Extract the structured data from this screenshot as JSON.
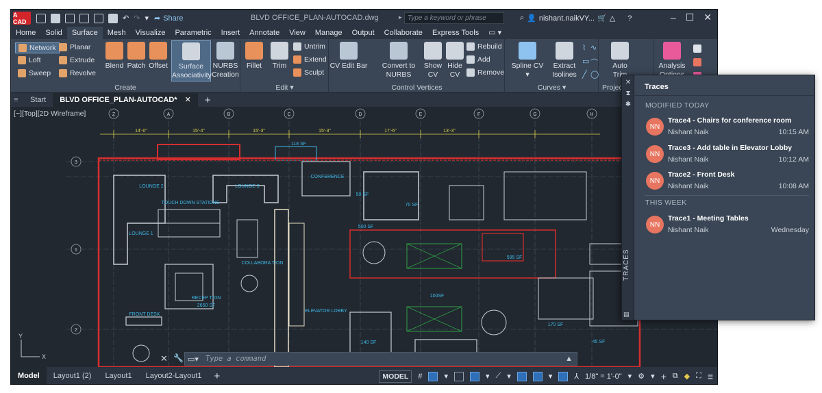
{
  "titlebar": {
    "logo": "A CAD",
    "share": "Share",
    "document": "BLVD OFFICE_PLAN-AUTOCAD.dwg",
    "search_placeholder": "Type a keyword or phrase",
    "user": "nishant.naikVY..."
  },
  "ribbon_tabs": [
    "Home",
    "Solid",
    "Surface",
    "Mesh",
    "Visualize",
    "Parametric",
    "Insert",
    "Annotate",
    "View",
    "Manage",
    "Output",
    "Collaborate",
    "Express Tools"
  ],
  "active_ribbon_tab": "Surface",
  "ribbon": {
    "create": {
      "label": "Create",
      "network": "Network",
      "planar": "Planar",
      "loft": "Loft",
      "extrude": "Extrude",
      "sweep": "Sweep",
      "revolve": "Revolve",
      "blend": "Blend",
      "patch": "Patch",
      "offset": "Offset",
      "surface_assoc_1": "Surface",
      "surface_assoc_2": "Associativity",
      "nurbs_1": "NURBS",
      "nurbs_2": "Creation"
    },
    "edit": {
      "label": "Edit",
      "fillet": "Fillet",
      "trim": "Trim",
      "untrim": "Untrim",
      "extend": "Extend",
      "sculpt": "Sculpt"
    },
    "cv": {
      "label": "Control Vertices",
      "cv_edit_bar": "CV Edit Bar",
      "convert_1": "Convert to",
      "convert_2": "NURBS",
      "show_1": "Show",
      "show_2": "CV",
      "hide_1": "Hide",
      "hide_2": "CV",
      "rebuild": "Rebuild",
      "add": "Add",
      "remove": "Remove"
    },
    "curves": {
      "label": "Curves",
      "spline_cv": "Spline CV",
      "extract_1": "Extract",
      "extract_2": "Isolines"
    },
    "project": {
      "label": "Project",
      "auto_1": "Auto",
      "auto_2": "Trim"
    },
    "analysis": {
      "label_1": "Analysis",
      "label_2": "Options"
    }
  },
  "file_tabs": {
    "start": "Start",
    "active": "BLVD OFFICE_PLAN-AUTOCAD*"
  },
  "canvas": {
    "view_label": "[−][Top][2D Wireframe]",
    "rooms": [
      "LOUNGE 2",
      "LOUNGE 3",
      "CONFERENCE",
      "TOUCH DOWN STATIONS",
      "LOUNGE 1",
      "COLLABORA TION",
      "RECEP TION",
      "2650 SF",
      "FRONT DESK",
      "ELEVATOR LOBBY",
      "118 SF",
      "50 SF",
      "70 SF",
      "500 SF",
      "100SF",
      "595 SF",
      "170 SF",
      "140 SF",
      "45 SF"
    ],
    "grid_letters": [
      "Z",
      "A",
      "B",
      "C",
      "D",
      "E",
      "F",
      "G",
      "H"
    ],
    "grid_numbers": [
      "3",
      "1",
      "1",
      "2"
    ],
    "dims": [
      "14'-0\"",
      "15'-4\"",
      "15'-3\"",
      "15'-3\"",
      "17'-6\"",
      "13'-3\""
    ],
    "command_placeholder": "Type a command"
  },
  "statusbar": {
    "layouts": [
      "Model",
      "Layout1 (2)",
      "Layout1",
      "Layout2-Layout1"
    ],
    "model_btn": "MODEL",
    "scale": "1/8\" = 1'-0\""
  },
  "traces": {
    "title": "Traces",
    "vertical_label": "TRACES",
    "section_today": "MODIFIED TODAY",
    "section_week": "THIS WEEK",
    "items": [
      {
        "avatar": "NN",
        "title": "Trace4 - Chairs for conference room",
        "author": "Nishant Naik",
        "time": "10:15 AM"
      },
      {
        "avatar": "NN",
        "title": "Trace3 - Add table in Elevator Lobby",
        "author": "Nishant Naik",
        "time": "10:12 AM"
      },
      {
        "avatar": "NN",
        "title": "Trace2 - Front Desk",
        "author": "Nishant Naik",
        "time": "10:08 AM"
      },
      {
        "avatar": "NN",
        "title": "Trace1 - Meeting Tables",
        "author": "Nishant Naik",
        "time": "Wednesday"
      }
    ]
  },
  "colors": {
    "background": "#212830",
    "ribbon": "#3a4655",
    "accent_blue": "#2f6fb8",
    "avatar": "#e87560",
    "wall_red": "#d62e2e",
    "dim_yellow": "#e0d34d",
    "room_cyan": "#3fb7e6"
  }
}
